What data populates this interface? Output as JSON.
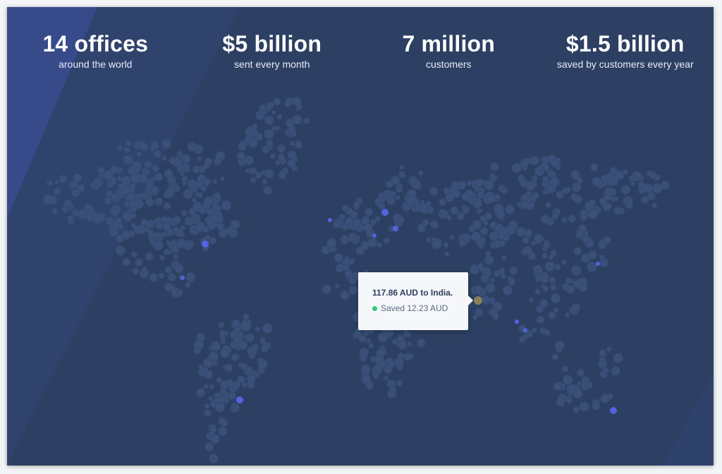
{
  "stats": [
    {
      "value": "14 offices",
      "label": "around the world"
    },
    {
      "value": "$5 billion",
      "label": "sent every month"
    },
    {
      "value": "7 million",
      "label": "customers"
    },
    {
      "value": "$1.5 billion",
      "label": "saved by customers every year"
    }
  ],
  "tooltip": {
    "amount": "117.86 AUD to India.",
    "saved": "Saved 12.23 AUD"
  },
  "colors": {
    "background": "#2d4063",
    "dot": "#3a5078",
    "highlight": "#5563e0",
    "active": "#8a7f5a",
    "saved_indicator": "#2ecc71"
  },
  "icons": {
    "saved_indicator": "green-dot-icon",
    "map_highlight": "location-dot-icon"
  }
}
